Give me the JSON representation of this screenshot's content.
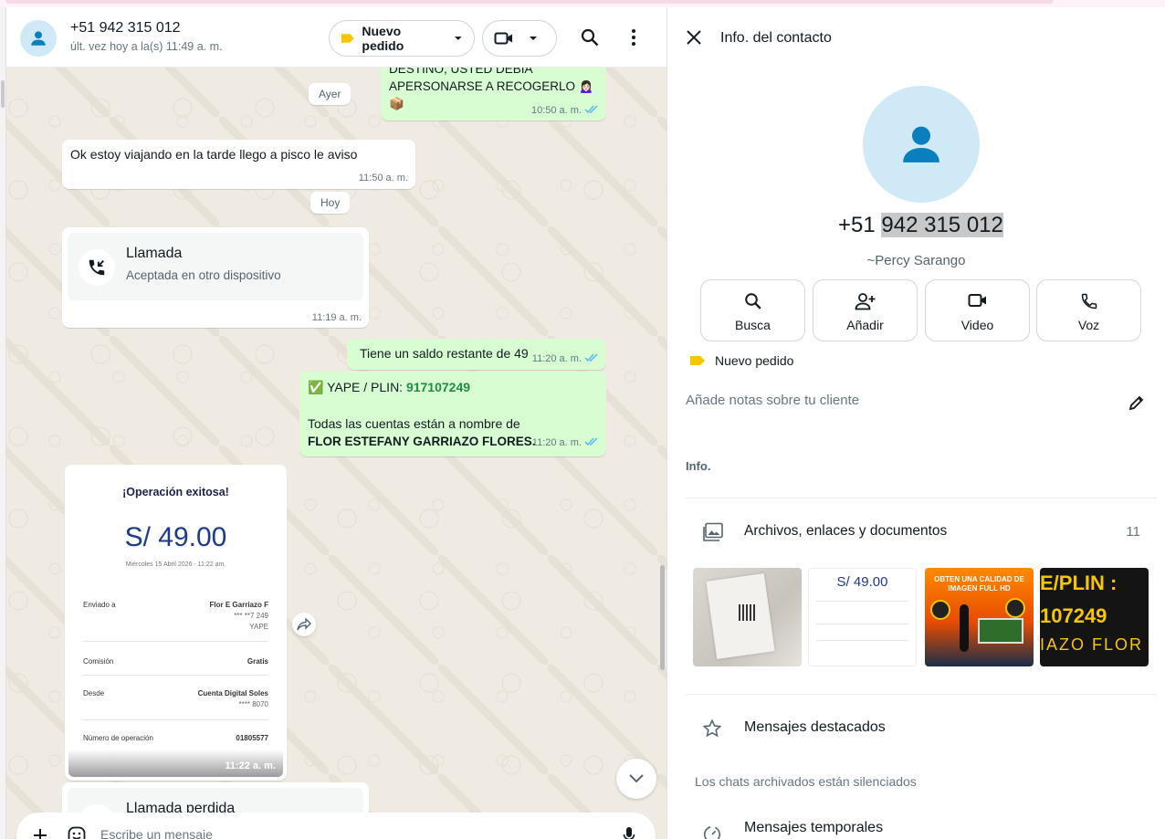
{
  "chat": {
    "contact_name": "+51 942 315 012",
    "status": "últ. vez hoy a la(s) 11:49 a. m.",
    "label_button": "Nuevo pedido",
    "colors": {
      "label_yellow": "#f7c600",
      "out_bubble": "#d9fdd3",
      "tick_blue": "#53bdeb",
      "link_green": "#1f8a4c",
      "missed_red": "#ea0038"
    },
    "messages": {
      "m1_lines": [
        "DESTINO, USTED DEBIA",
        "APERSONARSE A RECOGERLO 🙍🏻‍♀️",
        "📦"
      ],
      "m1_time": "10:50 a. m.",
      "day_ayer": "Ayer",
      "m2_text": "Ok estoy viajando en la tarde llego a pisco le aviso",
      "m2_time": "11:50 a. m.",
      "day_hoy": "Hoy",
      "call1_title": "Llamada",
      "call1_sub": "Aceptada en otro dispositivo",
      "call1_time": "11:19 a. m.",
      "m3_text": "Tiene un saldo restante de 49",
      "m3_time": "11:20 a. m.",
      "m4_prefix": "✅ YAPE / PLIN: ",
      "m4_number": "917107249",
      "m4_line2": "Todas las cuentas están a nombre de",
      "m4_bold": "FLOR ESTEFANY GARRIAZO FLORES.",
      "m4_time": "11:20 a. m.",
      "call2_title": "Llamada perdida"
    },
    "receipt": {
      "title": "¡Operación exitosa!",
      "amount": "S/ 49.00",
      "date": "Miércoles 15 Abril 2026 - 11:22 am.",
      "sent_to_label": "Enviado a",
      "sent_to_name": "Flor E Garriazo F",
      "sent_to_num": "*** **7 249",
      "sent_to_app": "YAPE",
      "fee_label": "Comisión",
      "fee_value": "Gratis",
      "from_label": "Desde",
      "from_value": "Cuenta Digital Soles",
      "from_num": "**** 8070",
      "op_label": "Número de operación",
      "op_value": "01805577",
      "time": "11:22 a. m."
    },
    "composer_placeholder": "Escribe un mensaje"
  },
  "info": {
    "title": "Info. del contacto",
    "phone_prefix": "+51 ",
    "phone_highlight": "942 315 012",
    "nickname": "~Percy Sarango",
    "actions": [
      "Busca",
      "Añadir",
      "Video",
      "Voz"
    ],
    "label": "Nuevo pedido",
    "notes_placeholder": "Añade notas sobre tu cliente",
    "info_heading": "Info.",
    "files_title": "Archivos, enlaces y documentos",
    "files_count": "11",
    "thumb2_amount": "S/ 49.00",
    "thumb3_lines": [
      "OBTEN UNA CALIDAD DE",
      "IMAGEN FULL HD"
    ],
    "thumb4_lines": [
      "E/PLIN :",
      "107249",
      "IAZO FLOR"
    ],
    "starred": "Mensajes destacados",
    "archived_note": "Los chats archivados están silenciados",
    "temporal": "Mensajes temporales"
  }
}
